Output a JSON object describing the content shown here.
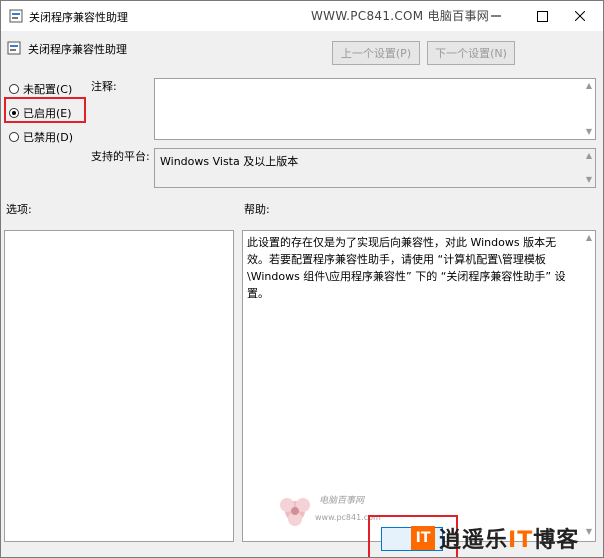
{
  "window": {
    "title": "关闭程序兼容性助理",
    "watermark": "WWW.PC841.COM 电脑百事网"
  },
  "policy": {
    "title": "关闭程序兼容性助理"
  },
  "nav": {
    "prev_label": "上一个设置(P)",
    "next_label": "下一个设置(N)"
  },
  "state": {
    "options": [
      {
        "label": "未配置(C)",
        "selected": false
      },
      {
        "label": "已启用(E)",
        "selected": true
      },
      {
        "label": "已禁用(D)",
        "selected": false
      }
    ]
  },
  "comment": {
    "label": "注释:",
    "value": ""
  },
  "platform": {
    "label": "支持的平台:",
    "value": "Windows Vista 及以上版本"
  },
  "options_panel": {
    "label": "选项:"
  },
  "help": {
    "label": "帮助:",
    "text": "此设置的存在仅是为了实现后向兼容性，对此 Windows 版本无效。若要配置程序兼容性助手，请使用 “计算机配置\\管理模板\\Windows 组件\\应用程序兼容性” 下的 “关闭程序兼容性助手” 设置。"
  },
  "brand": {
    "icon_text": "IT",
    "name_a": "逍遥乐",
    "name_it": "IT",
    "name_b": "博客",
    "logo_text": "电脑百事网",
    "logo_url": "www.pc841.com"
  },
  "colors": {
    "highlight": "#e0202a",
    "brand": "#ff6a00"
  }
}
